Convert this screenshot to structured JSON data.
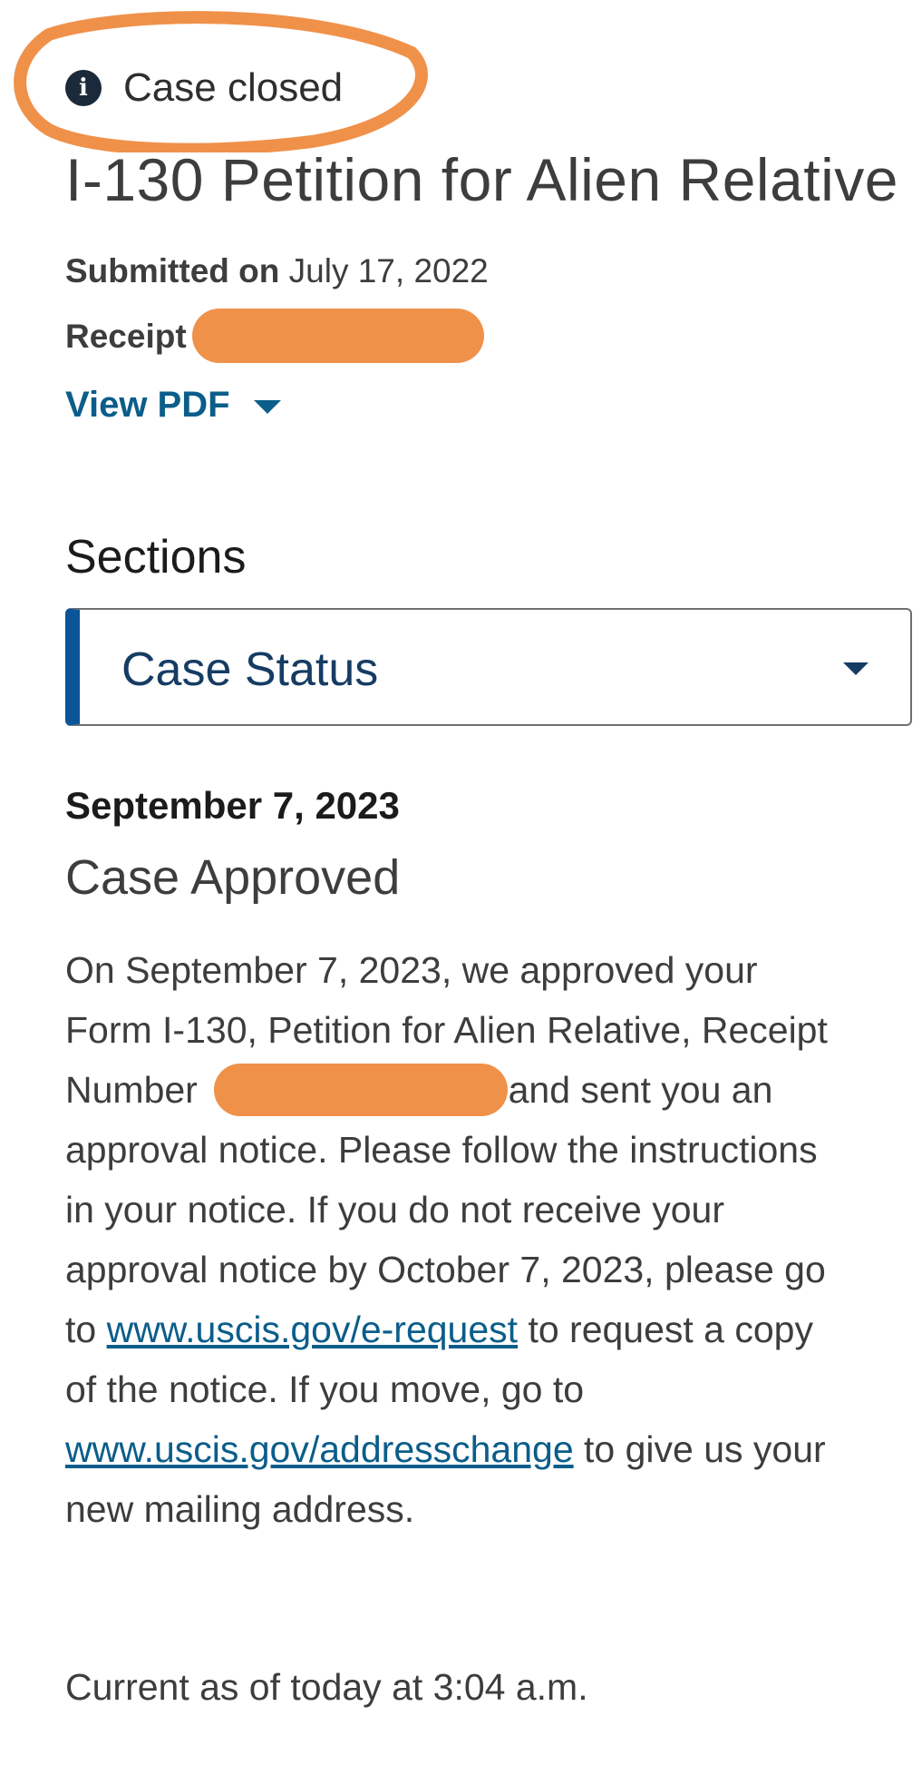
{
  "case_status_badge": {
    "icon": "info-icon",
    "icon_glyph": "i",
    "text": "Case closed",
    "annotation_color": "#f0914a"
  },
  "title": "I-130 Petition for Alien Relative",
  "submitted": {
    "label": "Submitted on",
    "value": "July 17, 2022"
  },
  "receipt": {
    "label": "Receipt #"
  },
  "view_pdf": {
    "label": "View PDF"
  },
  "sections": {
    "label": "Sections",
    "selected": "Case Status"
  },
  "event": {
    "date": "September 7, 2023",
    "title": "Case Approved",
    "line1": "On September 7, 2023, we approved your",
    "line2": "Form I-130, Petition for Alien Relative, Receipt",
    "line3_a": "Number",
    "line3_b": ", and sent you an",
    "line4": "approval notice. Please follow the instructions",
    "line5": "in your notice. If you do not receive your",
    "line6": "approval notice by October 7, 2023, please go",
    "line7_a": "to ",
    "line7_link": "www.uscis.gov/e-request",
    "line7_b": " to request a copy",
    "line8": "of the notice. If you move, go to",
    "line9_link": "www.uscis.gov/addresschange",
    "line9_b": " to give us your",
    "line10": "new mailing address."
  },
  "footer": {
    "text": "Current as of today at 3:04 a.m."
  },
  "colors": {
    "link": "#0b5d8a",
    "accent_bar": "#0b5496",
    "redaction": "#f0914a"
  }
}
